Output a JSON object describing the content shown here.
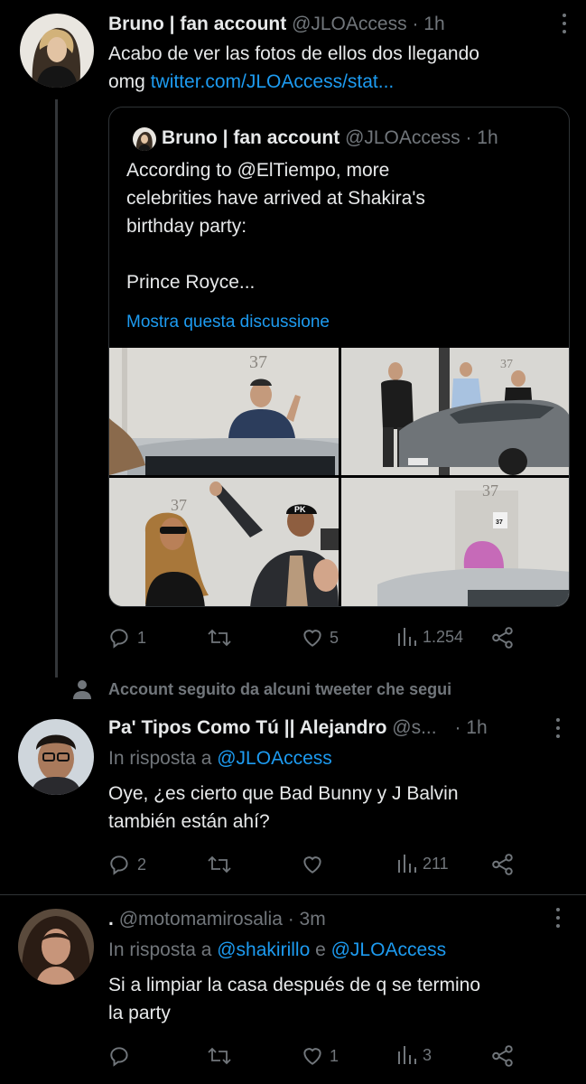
{
  "tweet1": {
    "name": "Bruno | fan account",
    "handle": "@JLOAccess",
    "time": "· 1h",
    "text_line1": "Acabo de ver las fotos de ellos dos llegando",
    "text_prefix": "omg ",
    "link": "twitter.com/JLOAccess/stat...",
    "quote": {
      "name": "Bruno | fan account",
      "handle": "@JLOAccess",
      "time": "· 1h",
      "line1": "According to @ElTiempo, more",
      "line2": "celebrities have arrived at Shakira's",
      "line3": "birthday party:",
      "line4": "Prince Royce...",
      "show_thread": "Mostra questa discussione",
      "photo1_number": "37",
      "photo2_number": "37",
      "photo3_number": "37",
      "photo3_cap": "PK",
      "photo4_number": "37",
      "photo4_sign": "37"
    },
    "actions": {
      "replies": "1",
      "likes": "5",
      "views": "1.254"
    }
  },
  "social_context": "Account seguito da alcuni tweeter che segui",
  "tweet2": {
    "name": "Pa' Tipos Como Tú || Alejandro",
    "handle": "@s...",
    "time": "· 1h",
    "reply_prefix": "In risposta a ",
    "reply_to": "@JLOAccess",
    "line1": "Oye, ¿es cierto que Bad Bunny y J Balvin",
    "line2": "también están ahí?",
    "actions": {
      "replies": "2",
      "views": "211"
    }
  },
  "tweet3": {
    "name": ".",
    "handle": "@motomamirosalia",
    "time": "· 3m",
    "reply_prefix": "In risposta a ",
    "reply_to1": "@shakirillo",
    "reply_and": " e ",
    "reply_to2": "@JLOAccess",
    "line1": "Si a limpiar la casa después de q se termino",
    "line2": "la party",
    "actions": {
      "likes": "1",
      "views": "3"
    }
  },
  "colors": {
    "background": "#000000",
    "primary_text": "#e7e9ea",
    "secondary_text": "#71767b",
    "link": "#1d9bf0",
    "border": "#2f3336"
  }
}
